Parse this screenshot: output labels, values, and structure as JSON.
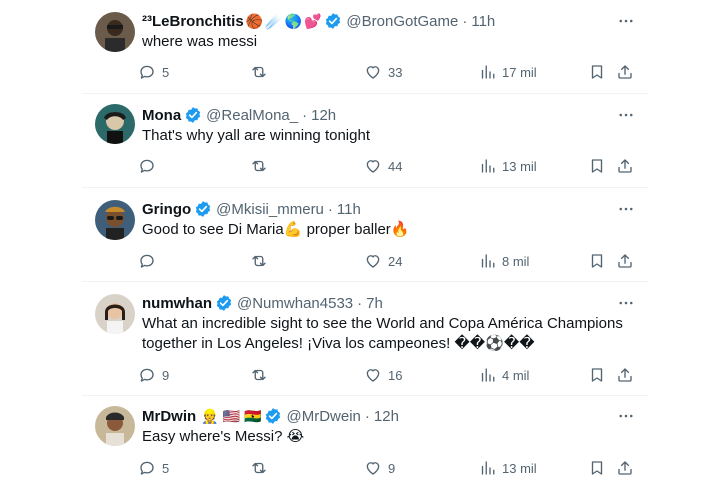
{
  "colors": {
    "verified": "#1d9bf0",
    "muted": "#536471",
    "text": "#0f1419",
    "divider": "#eff3f4"
  },
  "tweets": [
    {
      "name": "²³LeBronchitis",
      "name_emojis": [
        "🏀",
        "☄️",
        "🌎",
        "💕"
      ],
      "verified": true,
      "handle": "@BronGotGame",
      "time": "11h",
      "text": "where was messi",
      "replies": "5",
      "retweets": "",
      "likes": "33",
      "views": "17 mil"
    },
    {
      "name": "Mona",
      "name_emojis": [],
      "verified": true,
      "handle": "@RealMona_",
      "time": "12h",
      "text": "That's why yall are winning tonight",
      "replies": "",
      "retweets": "",
      "likes": "44",
      "views": "13 mil"
    },
    {
      "name": "Gringo",
      "name_emojis": [],
      "verified": true,
      "handle": "@Mkisii_mmeru",
      "time": "11h",
      "text": "Good to see Di Maria💪 proper baller🔥",
      "replies": "",
      "retweets": "",
      "likes": "24",
      "views": "8 mil"
    },
    {
      "name": "numwhan",
      "name_emojis": [],
      "verified": true,
      "handle": "@Numwhan4533",
      "time": "7h",
      "text": "What an incredible sight to see the World and Copa América Champions together in Los Angeles! ¡Viva los campeones! ��⚽��",
      "replies": "9",
      "retweets": "",
      "likes": "16",
      "views": "4 mil"
    },
    {
      "name": "MrDwin",
      "name_emojis": [
        "👷",
        "🇺🇸",
        "🇬🇭"
      ],
      "verified": true,
      "handle": "@MrDwein",
      "time": "12h",
      "text": "Easy where's Messi? 😭",
      "replies": "5",
      "retweets": "",
      "likes": "9",
      "views": "13 mil"
    }
  ]
}
